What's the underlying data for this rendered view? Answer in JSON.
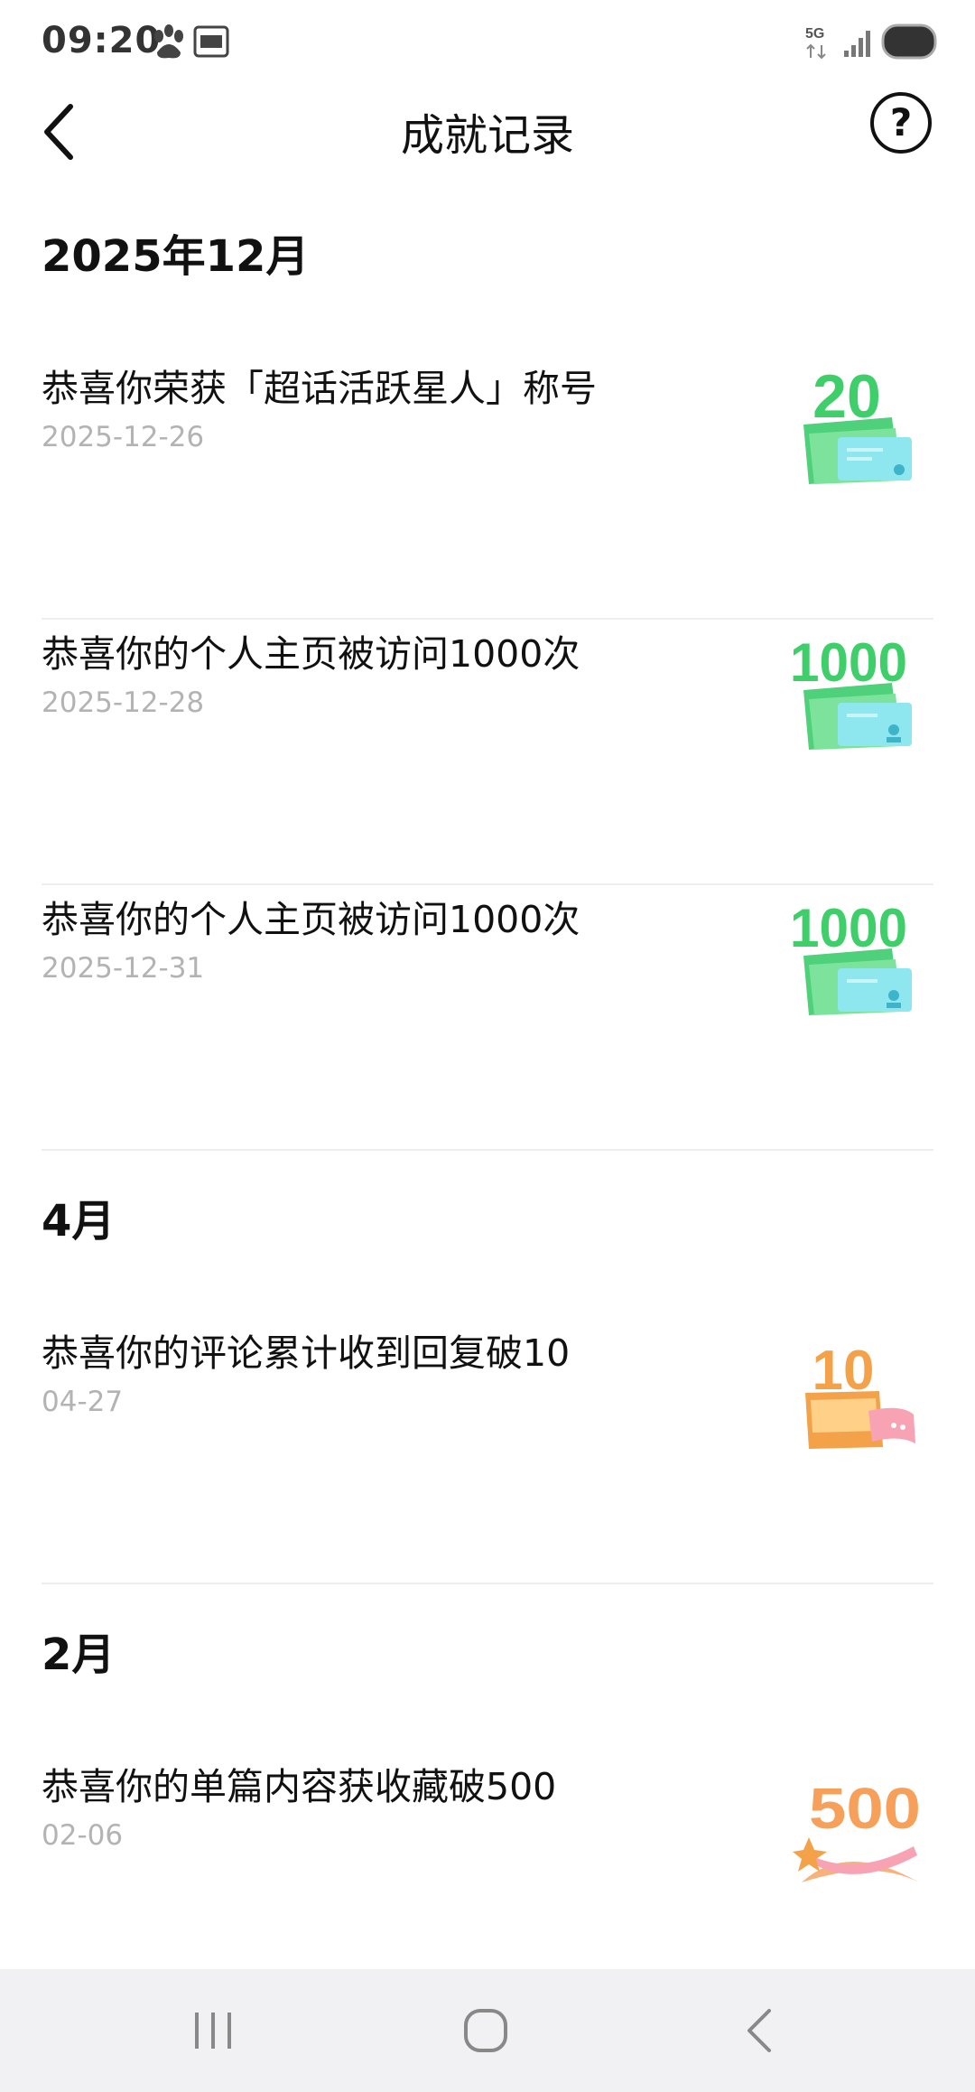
{
  "status_bar": {
    "time": "09:20",
    "notification_icons": [
      "baidu-paw-icon",
      "toutiao-icon"
    ],
    "network_label": "5G",
    "system_icons": [
      "5g-network-icon",
      "signal-bars-icon",
      "battery-icon"
    ]
  },
  "header": {
    "title": "成就记录",
    "back_icon": "chevron-left-icon",
    "help_label": "?"
  },
  "sections": [
    {
      "title": "2025年12月"
    },
    {
      "title": "4月"
    },
    {
      "title": "2月"
    }
  ],
  "items": [
    {
      "title": "恭喜你荣获「超话活跃星人」称号",
      "date": "2025-12-26",
      "badge_number": "20",
      "badge_theme": "green"
    },
    {
      "title": "恭喜你的个人主页被访问1000次",
      "date": "2025-12-28",
      "badge_number": "1000",
      "badge_theme": "green"
    },
    {
      "title": "恭喜你的个人主页被访问1000次",
      "date": "2025-12-31",
      "badge_number": "1000",
      "badge_theme": "green"
    },
    {
      "title": "恭喜你的评论累计收到回复破10",
      "date": "04-27",
      "badge_number": "10",
      "badge_theme": "orange"
    },
    {
      "title": "恭喜你的单篇内容获收藏破500",
      "date": "02-06",
      "badge_number": "500",
      "badge_theme": "orange"
    }
  ],
  "colors": {
    "green_badge": "#3fcf6a",
    "cyan_card": "#8ee6ee",
    "orange_badge": "#f4a24a",
    "pink_ribbon": "#f7a3b3",
    "date_gray": "#b3b3b3",
    "divider": "#eeeeee"
  },
  "nav_bar": {
    "icons": [
      "recent-apps-icon",
      "home-icon",
      "back-icon"
    ]
  }
}
